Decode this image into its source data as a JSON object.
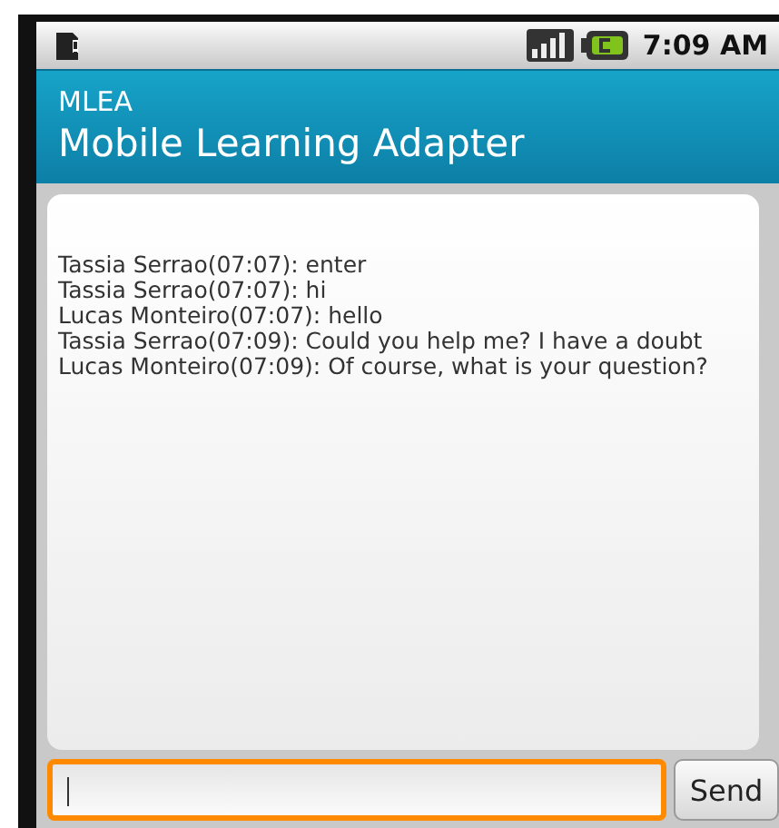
{
  "status_bar": {
    "time": "7:09 AM"
  },
  "app_bar": {
    "subtitle": "MLEA",
    "title": "Mobile Learning Adapter"
  },
  "messages": [
    {
      "text": "Tassia Serrao(07:07): enter"
    },
    {
      "text": "Tassia Serrao(07:07): hi"
    },
    {
      "text": "Lucas Monteiro(07:07): hello"
    },
    {
      "text": "Tassia Serrao(07:09): Could you help me? I have a doubt"
    },
    {
      "text": "Lucas Monteiro(07:09): Of course, what is your question?"
    }
  ],
  "compose": {
    "focused": true,
    "button": "Send"
  }
}
